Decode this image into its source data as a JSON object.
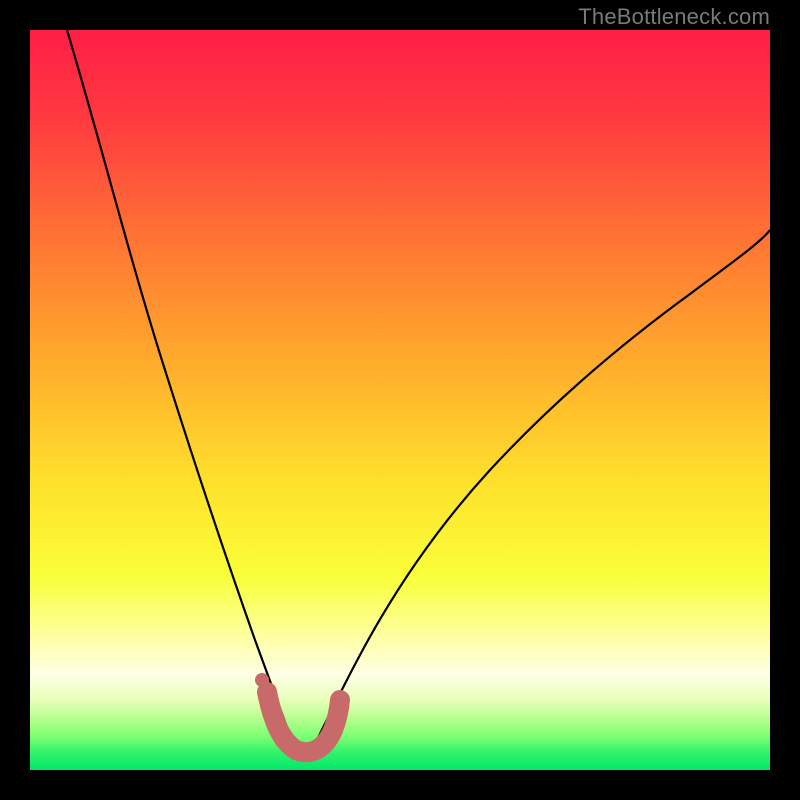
{
  "watermark": "TheBottleneck.com",
  "colors": {
    "black": "#000000",
    "curve": "#000000",
    "marker": "#c96a6a"
  },
  "chart_data": {
    "type": "line",
    "title": "",
    "xlabel": "",
    "ylabel": "",
    "xlim": [
      0,
      1
    ],
    "ylim": [
      0,
      1
    ],
    "note": "V-shaped bottleneck curve over vertical rainbow gradient (red→orange→yellow→green). Trough highlighted with salmon U-shaped marker band. Axes and ticks are not shown; values are normalized 0–1 estimates of pixel positions within the 740×740 plot area.",
    "gradient_stops": [
      {
        "offset": 0.0,
        "color": "#ff1e46"
      },
      {
        "offset": 0.12,
        "color": "#ff3a3f"
      },
      {
        "offset": 0.3,
        "color": "#ff7a33"
      },
      {
        "offset": 0.48,
        "color": "#ffb62b"
      },
      {
        "offset": 0.62,
        "color": "#ffe32c"
      },
      {
        "offset": 0.74,
        "color": "#f9ff3a"
      },
      {
        "offset": 0.83,
        "color": "#ffffb0"
      },
      {
        "offset": 0.87,
        "color": "#ffffe6"
      },
      {
        "offset": 0.905,
        "color": "#e8ffb8"
      },
      {
        "offset": 0.93,
        "color": "#b7ff8e"
      },
      {
        "offset": 0.955,
        "color": "#7cff74"
      },
      {
        "offset": 0.975,
        "color": "#35f46a"
      },
      {
        "offset": 1.0,
        "color": "#00e86a"
      }
    ],
    "series": [
      {
        "name": "left-branch",
        "x": [
          0.05,
          0.09,
          0.13,
          0.17,
          0.21,
          0.245,
          0.275,
          0.3,
          0.32,
          0.335,
          0.348,
          0.36
        ],
        "y": [
          0.0,
          0.14,
          0.29,
          0.43,
          0.56,
          0.67,
          0.76,
          0.83,
          0.885,
          0.925,
          0.955,
          0.975
        ]
      },
      {
        "name": "right-branch",
        "x": [
          0.38,
          0.395,
          0.415,
          0.445,
          0.485,
          0.54,
          0.605,
          0.68,
          0.76,
          0.85,
          0.94,
          1.0
        ],
        "y": [
          0.975,
          0.95,
          0.91,
          0.855,
          0.79,
          0.71,
          0.625,
          0.54,
          0.455,
          0.375,
          0.305,
          0.26
        ]
      },
      {
        "name": "trough-marker-band",
        "x": [
          0.32,
          0.33,
          0.345,
          0.36,
          0.375,
          0.39,
          0.405,
          0.418
        ],
        "y": [
          0.895,
          0.935,
          0.965,
          0.975,
          0.975,
          0.968,
          0.945,
          0.905
        ]
      }
    ],
    "marker_dot": {
      "x": 0.314,
      "y": 0.878
    }
  }
}
